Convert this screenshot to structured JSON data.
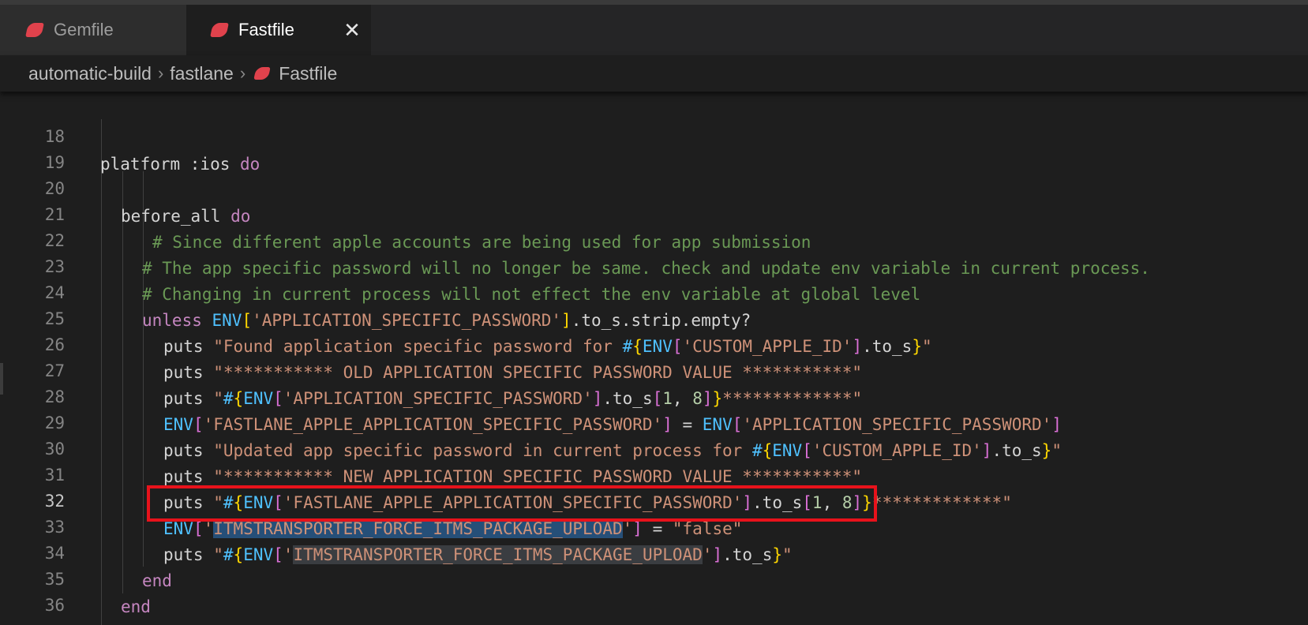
{
  "tabs": [
    {
      "label": "Gemfile",
      "active": false,
      "icon": "ruby-icon"
    },
    {
      "label": "Fastfile",
      "active": true,
      "icon": "ruby-icon",
      "close": "✕"
    }
  ],
  "breadcrumb": {
    "items": [
      "automatic-build",
      "fastlane",
      "Fastfile"
    ],
    "separator": "›"
  },
  "editor": {
    "current_line": 32,
    "lines": [
      {
        "n": "18"
      },
      {
        "n": "19"
      },
      {
        "n": "20"
      },
      {
        "n": "21"
      },
      {
        "n": "22"
      },
      {
        "n": "23"
      },
      {
        "n": "24"
      },
      {
        "n": "25"
      },
      {
        "n": "26"
      },
      {
        "n": "27"
      },
      {
        "n": "28"
      },
      {
        "n": "29"
      },
      {
        "n": "30"
      },
      {
        "n": "31"
      },
      {
        "n": "32"
      },
      {
        "n": "33"
      },
      {
        "n": "34"
      },
      {
        "n": "35"
      },
      {
        "n": "36"
      }
    ],
    "text": {
      "l18_a": "platform :ios ",
      "l18_b": "do",
      "l20_a": "before_all ",
      "l20_b": "do",
      "l21": "# Since different apple accounts are being used for app submission",
      "l22": "# The app specific password will no longer be same. check and update env variable in current process.",
      "l23": "# Changing in current process will not effect the env variable at global level",
      "l24_kw": "unless ",
      "l24_env": "ENV",
      "l24_str": "'APPLICATION_SPECIFIC_PASSWORD'",
      "l24_rest": ".to_s.strip.empty?",
      "puts": "puts ",
      "env": "ENV",
      "l25_s1": "\"Found application specific password for ",
      "l25_key": "'CUSTOM_APPLE_ID'",
      "l25_rest": ".to_s",
      "l26": "\"*********** OLD APPLICATION SPECIFIC PASSWORD VALUE ***********\"",
      "l27_key": "'APPLICATION_SPECIFIC_PASSWORD'",
      "l27_rest": ".to_s",
      "l27_n1": "1",
      "l27_n2": "8",
      "l27_tail": "*************\"",
      "l28_key1": "'FASTLANE_APPLE_APPLICATION_SPECIFIC_PASSWORD'",
      "l28_eq": " = ",
      "l28_key2": "'APPLICATION_SPECIFIC_PASSWORD'",
      "l29_s1": "\"Updated app specific password in current process for ",
      "l29_key": "'CUSTOM_APPLE_ID'",
      "l29_rest": ".to_s",
      "l30": "\"*********** NEW APPLICATION SPECIFIC PASSWORD VALUE ***********\"",
      "l31_key": "'FASTLANE_APPLE_APPLICATION_SPECIFIC_PASSWORD'",
      "l31_rest": ".to_s",
      "l31_n1": "1",
      "l31_n2": "8",
      "l31_tail": "*************\"",
      "l32_sel": "ITMSTRANSPORTER_FORCE_ITMS_PACKAGE_UPLOAD",
      "l32_eq": " = ",
      "l32_val": "\"false\"",
      "l33_sel": "ITMSTRANSPORTER_FORCE_ITMS_PACKAGE_UPLOAD",
      "l33_rest": ".to_s",
      "end": "end"
    }
  },
  "colors": {
    "highlight_box": "#e8121b",
    "keyword": "#c586c0",
    "comment": "#6a9955",
    "string": "#ce9178",
    "constant": "#4fc1ff"
  }
}
